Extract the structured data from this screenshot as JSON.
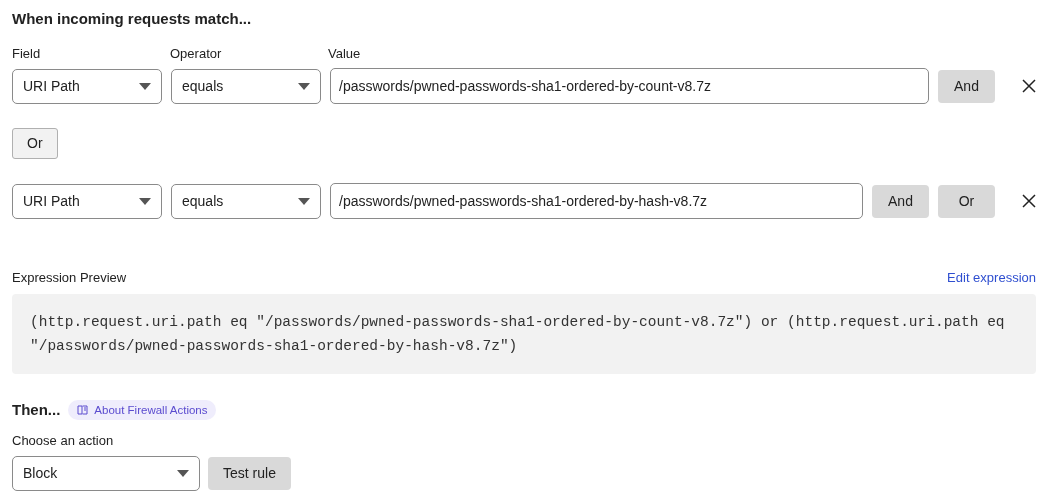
{
  "heading": "When incoming requests match...",
  "column_labels": [
    "Field",
    "Operator",
    "Value"
  ],
  "conditions": [
    {
      "field": "URI Path",
      "operator": "equals",
      "value": "/passwords/pwned-passwords-sha1-ordered-by-count-v8.7z",
      "buttons": [
        "And"
      ]
    },
    {
      "field": "URI Path",
      "operator": "equals",
      "value": "/passwords/pwned-passwords-sha1-ordered-by-hash-v8.7z",
      "buttons": [
        "And",
        "Or"
      ]
    }
  ],
  "group_button": "Or",
  "expression": {
    "label": "Expression Preview",
    "edit_link": "Edit expression",
    "text": "(http.request.uri.path eq \"/passwords/pwned-passwords-sha1-ordered-by-count-v8.7z\") or (http.request.uri.path eq \"/passwords/pwned-passwords-sha1-ordered-by-hash-v8.7z\")"
  },
  "then": {
    "heading": "Then...",
    "help_link": "About Firewall Actions",
    "action_label": "Choose an action",
    "action": "Block",
    "test_button": "Test rule"
  }
}
